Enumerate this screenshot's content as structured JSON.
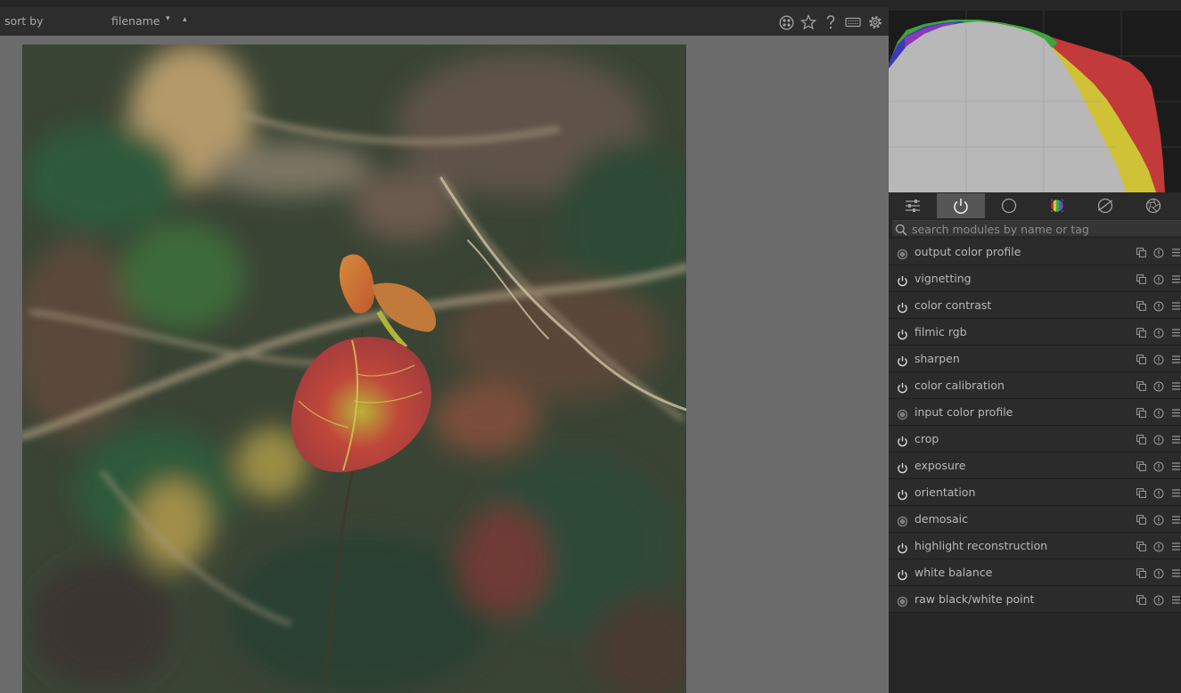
{
  "topbar": {
    "sort_label": "sort by",
    "sort_value": "filename",
    "sort_caret": "▾",
    "sort_direction": "▴",
    "icons": [
      "grouping-icon",
      "star-icon",
      "help-icon",
      "keyboard-icon",
      "gear-icon"
    ]
  },
  "histogram": {
    "channels": [
      "red",
      "green",
      "blue",
      "yellow",
      "white"
    ]
  },
  "module_groups": [
    {
      "name": "quick-access-icon",
      "active": false
    },
    {
      "name": "active-modules-icon",
      "active": true
    },
    {
      "name": "base-icon",
      "active": false
    },
    {
      "name": "color-icon",
      "active": false
    },
    {
      "name": "correct-icon",
      "active": false
    },
    {
      "name": "effect-icon",
      "active": false
    }
  ],
  "search": {
    "placeholder": "search modules by name or tag"
  },
  "modules": [
    {
      "name": "output color profile",
      "state": "always-on"
    },
    {
      "name": "vignetting",
      "state": "on"
    },
    {
      "name": "color contrast",
      "state": "on"
    },
    {
      "name": "filmic rgb",
      "state": "on"
    },
    {
      "name": "sharpen",
      "state": "on"
    },
    {
      "name": "color calibration",
      "state": "on"
    },
    {
      "name": "input color profile",
      "state": "always-on"
    },
    {
      "name": "crop",
      "state": "on"
    },
    {
      "name": "exposure",
      "state": "on"
    },
    {
      "name": "orientation",
      "state": "on"
    },
    {
      "name": "demosaic",
      "state": "always-on"
    },
    {
      "name": "highlight reconstruction",
      "state": "on"
    },
    {
      "name": "white balance",
      "state": "on"
    },
    {
      "name": "raw black/white point",
      "state": "always-on"
    }
  ],
  "colors": {
    "accent_active_tab": "#565656",
    "panel_bg": "#262626",
    "center_bg": "#6b6b6b"
  }
}
